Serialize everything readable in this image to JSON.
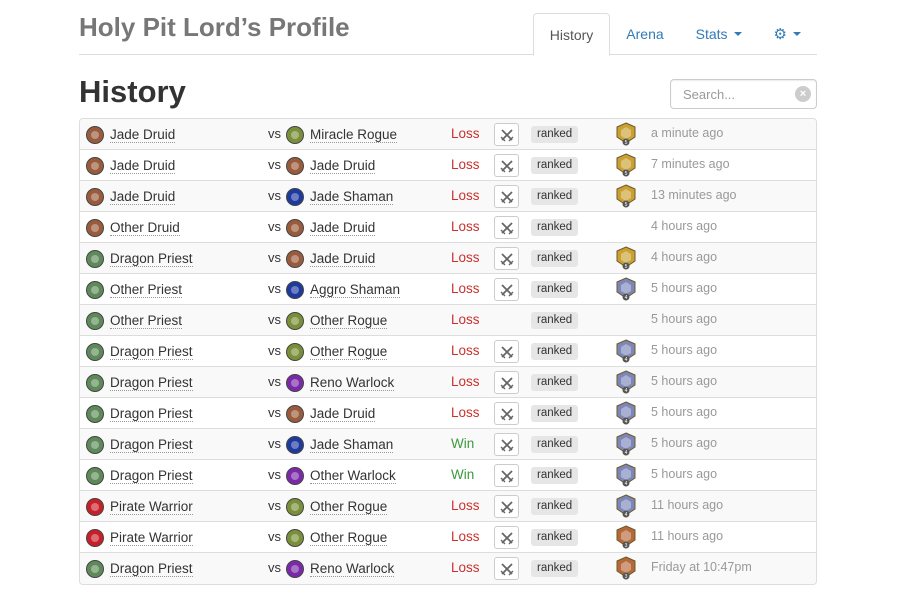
{
  "header": {
    "profile_title": "Holy Pit Lord’s Profile",
    "tabs": [
      {
        "label": "History",
        "active": true
      },
      {
        "label": "Arena",
        "active": false
      },
      {
        "label": "Stats",
        "active": false,
        "dropdown": true
      }
    ],
    "settings_icon": "gear-icon"
  },
  "page_title": "History",
  "search": {
    "placeholder": "Search...",
    "value": ""
  },
  "colors": {
    "loss": "#c9302c",
    "win": "#3c9a3c",
    "link": "#337ab7",
    "druid": "#9a5b3c",
    "priest": "#5e8a5a",
    "rogue": "#7a8f3a",
    "shaman": "#1f3a9e",
    "warlock": "#7a2aa8",
    "warrior": "#c8202a",
    "rank_gold": "#c9a031",
    "rank_silver": "#7d86b8",
    "rank_bronze": "#b5683a"
  },
  "games": [
    {
      "deck": "Jade Druid",
      "deck_hero": "druid",
      "vs": "vs",
      "opponent": "Miracle Rogue",
      "opp_hero": "rogue",
      "result": "Loss",
      "mode_icon": "crossed-swords-icon",
      "badge": "ranked",
      "rank": "5",
      "rank_tier": "gold",
      "time": "a minute ago"
    },
    {
      "deck": "Jade Druid",
      "deck_hero": "druid",
      "vs": "vs",
      "opponent": "Jade Druid",
      "opp_hero": "druid",
      "result": "Loss",
      "mode_icon": "crossed-swords-icon",
      "badge": "ranked",
      "rank": "5",
      "rank_tier": "gold",
      "time": "7 minutes ago"
    },
    {
      "deck": "Jade Druid",
      "deck_hero": "druid",
      "vs": "vs",
      "opponent": "Jade Shaman",
      "opp_hero": "shaman",
      "result": "Loss",
      "mode_icon": "crossed-swords-icon",
      "badge": "ranked",
      "rank": "5",
      "rank_tier": "gold",
      "time": "13 minutes ago"
    },
    {
      "deck": "Other Druid",
      "deck_hero": "druid",
      "vs": "vs",
      "opponent": "Jade Druid",
      "opp_hero": "druid",
      "result": "Loss",
      "mode_icon": "crossed-swords-icon",
      "badge": "ranked",
      "rank": "",
      "rank_tier": "",
      "time": "4 hours ago"
    },
    {
      "deck": "Dragon Priest",
      "deck_hero": "priest",
      "vs": "vs",
      "opponent": "Jade Druid",
      "opp_hero": "druid",
      "result": "Loss",
      "mode_icon": "crossed-swords-icon",
      "badge": "ranked",
      "rank": "5",
      "rank_tier": "gold",
      "time": "4 hours ago"
    },
    {
      "deck": "Other Priest",
      "deck_hero": "priest",
      "vs": "vs",
      "opponent": "Aggro Shaman",
      "opp_hero": "shaman",
      "result": "Loss",
      "mode_icon": "crossed-swords-icon",
      "badge": "ranked",
      "rank": "4",
      "rank_tier": "silver",
      "time": "5 hours ago"
    },
    {
      "deck": "Other Priest",
      "deck_hero": "priest",
      "vs": "vs",
      "opponent": "Other Rogue",
      "opp_hero": "rogue",
      "result": "Loss",
      "mode_icon": "",
      "badge": "ranked",
      "rank": "",
      "rank_tier": "",
      "time": "5 hours ago"
    },
    {
      "deck": "Dragon Priest",
      "deck_hero": "priest",
      "vs": "vs",
      "opponent": "Other Rogue",
      "opp_hero": "rogue",
      "result": "Loss",
      "mode_icon": "crossed-swords-icon",
      "badge": "ranked",
      "rank": "4",
      "rank_tier": "silver",
      "time": "5 hours ago"
    },
    {
      "deck": "Dragon Priest",
      "deck_hero": "priest",
      "vs": "vs",
      "opponent": "Reno Warlock",
      "opp_hero": "warlock",
      "result": "Loss",
      "mode_icon": "crossed-swords-icon",
      "badge": "ranked",
      "rank": "4",
      "rank_tier": "silver",
      "time": "5 hours ago"
    },
    {
      "deck": "Dragon Priest",
      "deck_hero": "priest",
      "vs": "vs",
      "opponent": "Jade Druid",
      "opp_hero": "druid",
      "result": "Loss",
      "mode_icon": "crossed-swords-icon",
      "badge": "ranked",
      "rank": "4",
      "rank_tier": "silver",
      "time": "5 hours ago"
    },
    {
      "deck": "Dragon Priest",
      "deck_hero": "priest",
      "vs": "vs",
      "opponent": "Jade Shaman",
      "opp_hero": "shaman",
      "result": "Win",
      "mode_icon": "crossed-swords-icon",
      "badge": "ranked",
      "rank": "4",
      "rank_tier": "silver",
      "time": "5 hours ago"
    },
    {
      "deck": "Dragon Priest",
      "deck_hero": "priest",
      "vs": "vs",
      "opponent": "Other Warlock",
      "opp_hero": "warlock",
      "result": "Win",
      "mode_icon": "crossed-swords-icon",
      "badge": "ranked",
      "rank": "4",
      "rank_tier": "silver",
      "time": "5 hours ago"
    },
    {
      "deck": "Pirate Warrior",
      "deck_hero": "warrior",
      "vs": "vs",
      "opponent": "Other Rogue",
      "opp_hero": "rogue",
      "result": "Loss",
      "mode_icon": "crossed-swords-icon",
      "badge": "ranked",
      "rank": "4",
      "rank_tier": "silver",
      "time": "11 hours ago"
    },
    {
      "deck": "Pirate Warrior",
      "deck_hero": "warrior",
      "vs": "vs",
      "opponent": "Other Rogue",
      "opp_hero": "rogue",
      "result": "Loss",
      "mode_icon": "crossed-swords-icon",
      "badge": "ranked",
      "rank": "3",
      "rank_tier": "bronze",
      "time": "11 hours ago"
    },
    {
      "deck": "Dragon Priest",
      "deck_hero": "priest",
      "vs": "vs",
      "opponent": "Reno Warlock",
      "opp_hero": "warlock",
      "result": "Loss",
      "mode_icon": "crossed-swords-icon",
      "badge": "ranked",
      "rank": "3",
      "rank_tier": "bronze",
      "time": "Friday at 10:47pm"
    }
  ]
}
